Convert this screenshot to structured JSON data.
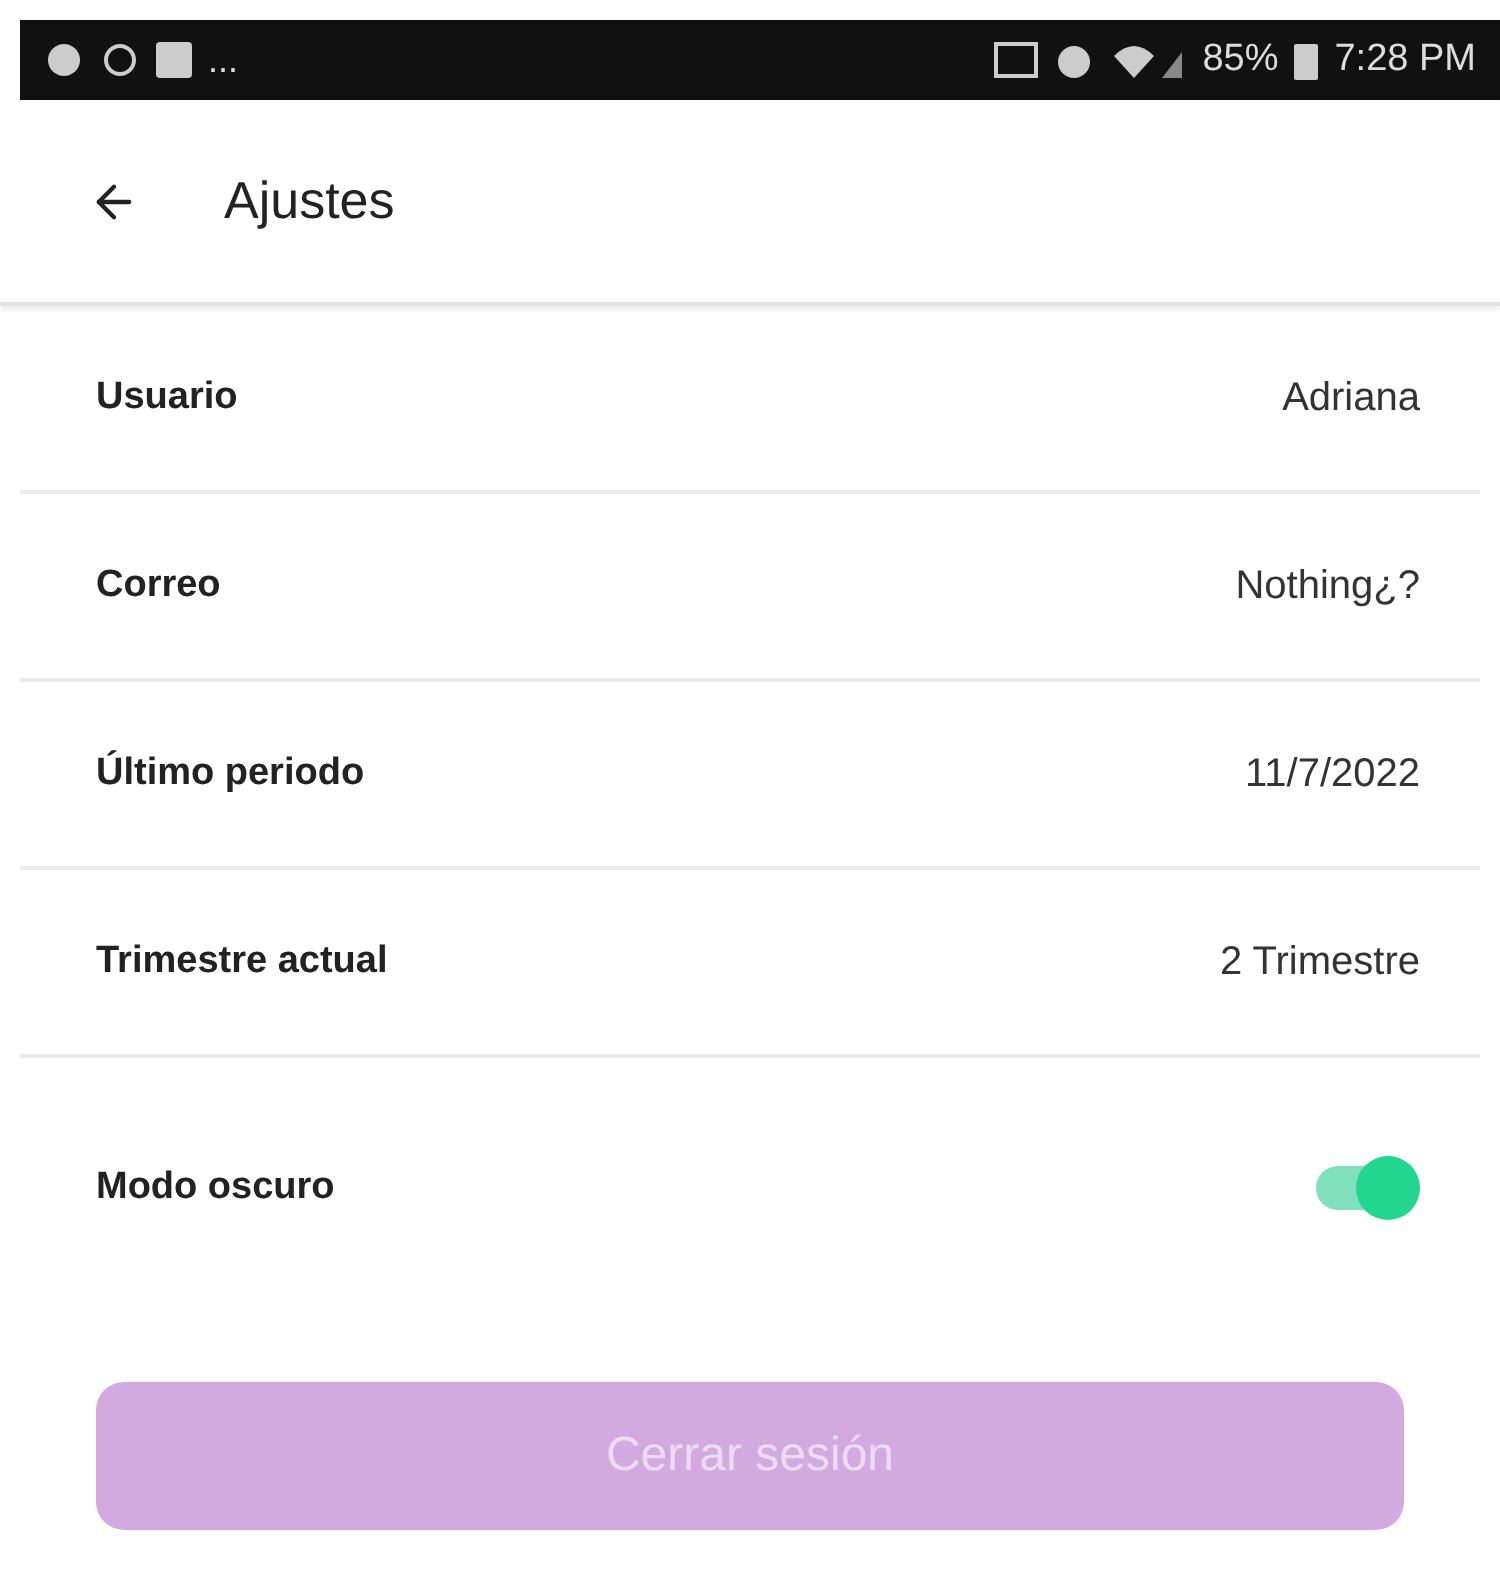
{
  "status_bar": {
    "more": "...",
    "battery": "85%",
    "time": "7:28 PM"
  },
  "header": {
    "title": "Ajustes"
  },
  "rows": [
    {
      "kind": "text",
      "label": "Usuario",
      "value": "Adriana"
    },
    {
      "kind": "text",
      "label": "Correo",
      "value": "Nothing¿?"
    },
    {
      "kind": "text",
      "label": "Último periodo",
      "value": "11/7/2022"
    },
    {
      "kind": "text",
      "label": "Trimestre actual",
      "value": "2 Trimestre"
    },
    {
      "kind": "switch",
      "label": "Modo oscuro",
      "on": true
    }
  ],
  "logout_button": {
    "label": "Cerrar sesión",
    "disabled": true
  }
}
